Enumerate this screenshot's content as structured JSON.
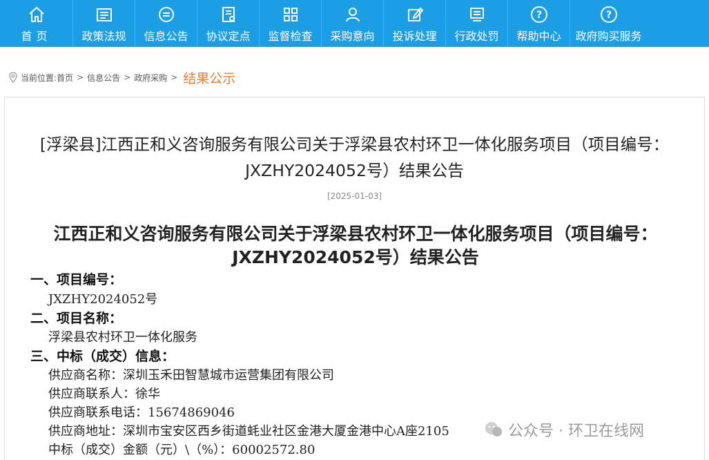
{
  "nav": [
    {
      "label": "首页",
      "icon": "home-icon"
    },
    {
      "label": "政策法规",
      "icon": "document-list-icon"
    },
    {
      "label": "信息公告",
      "icon": "announcement-icon"
    },
    {
      "label": "协议定点",
      "icon": "contract-icon"
    },
    {
      "label": "监督检查",
      "icon": "grid-icon"
    },
    {
      "label": "采购意向",
      "icon": "user-icon"
    },
    {
      "label": "投诉处理",
      "icon": "edit-icon"
    },
    {
      "label": "行政处罚",
      "icon": "penalty-icon"
    },
    {
      "label": "帮助中心",
      "icon": "help-icon"
    },
    {
      "label": "政府购买服务",
      "icon": "help-icon"
    }
  ],
  "breadcrumb": {
    "prefix": "当前位置:",
    "items": [
      "首页",
      "信息公告",
      "政府采购"
    ],
    "separator": ">",
    "current": "结果公示"
  },
  "article": {
    "header_title": "[浮梁县]江西正和义咨询服务有限公司关于浮梁县农村环卫一体化服务项目（项目编号：JXZHY2024052号）结果公告",
    "date": "[2025-01-03]",
    "title": "江西正和义咨询服务有限公司关于浮梁县农村环卫一体化服务项目（项目编号：JXZHY2024052号）结果公告",
    "sections": [
      {
        "heading": "一、项目编号：",
        "lines": [
          "JXZHY2024052号"
        ]
      },
      {
        "heading": "二、项目名称：",
        "lines": [
          "浮梁县农村环卫一体化服务"
        ]
      },
      {
        "heading": "三、中标（成交）信息：",
        "lines": [
          "供应商名称：深圳玉禾田智慧城市运营集团有限公司",
          "供应商联系人：徐华",
          "供应商联系电话：15674869046",
          "供应商地址：深圳市宝安区西乡街道蚝业社区金港大厦金港中心A座2105",
          "中标（成交）金额（元）\\（%）：60002572.80"
        ]
      }
    ]
  },
  "watermark": "公众号 · 环卫在线网",
  "colors": {
    "nav_bg": "#1c9ee4",
    "current_crumb": "#ef7d26"
  }
}
